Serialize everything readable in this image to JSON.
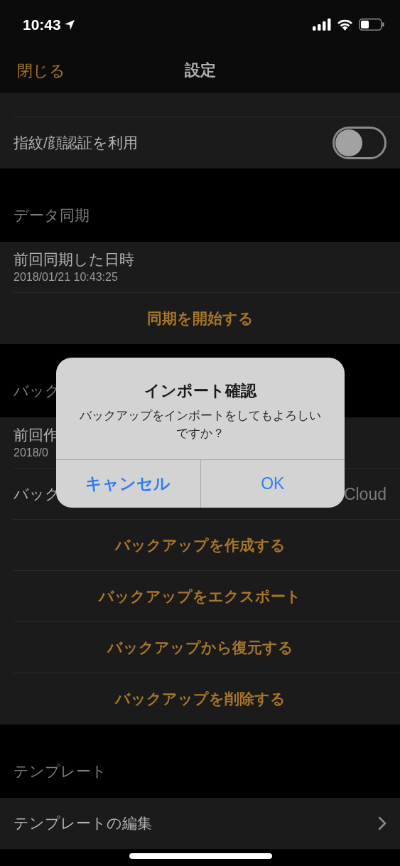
{
  "status_bar": {
    "time": "10:43"
  },
  "nav": {
    "close": "閉じる",
    "title": "設定"
  },
  "sections": [
    {
      "rows": [
        {
          "kind": "clipped"
        },
        {
          "kind": "toggle",
          "label": "指紋/顔認証を利用",
          "on": false
        }
      ]
    },
    {
      "header": "データ同期",
      "rows": [
        {
          "kind": "detail",
          "label": "前回同期した日時",
          "sub": "2018/01/21 10:43:25"
        },
        {
          "kind": "action",
          "label": "同期を開始する"
        }
      ]
    },
    {
      "header": "バック",
      "rows": [
        {
          "kind": "detail",
          "label": "前回作",
          "sub": "2018/0"
        },
        {
          "kind": "value",
          "label": "バック",
          "value": "Cloud"
        },
        {
          "kind": "action",
          "label": "バックアップを作成する"
        },
        {
          "kind": "action",
          "label": "バックアップをエクスポート"
        },
        {
          "kind": "action",
          "label": "バックアップから復元する"
        },
        {
          "kind": "action",
          "label": "バックアップを削除する"
        }
      ]
    },
    {
      "header": "テンプレート",
      "rows": [
        {
          "kind": "link",
          "label": "テンプレートの編集"
        }
      ]
    }
  ],
  "alert": {
    "title": "インポート確認",
    "message": "バックアップをインポートをしてもよろしいですか？",
    "buttons": [
      {
        "label": "キャンセル",
        "kind": "cancel"
      },
      {
        "label": "OK",
        "kind": "default"
      }
    ]
  }
}
